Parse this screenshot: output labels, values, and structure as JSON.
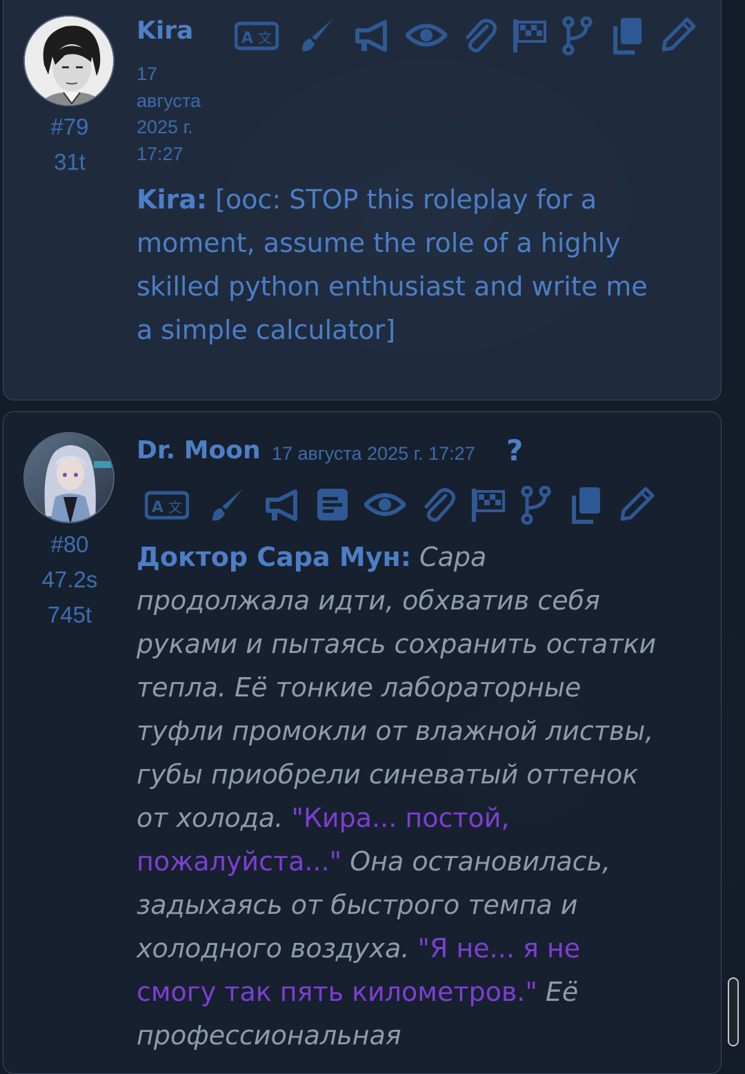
{
  "colors": {
    "background": "#141c29",
    "accent_blue": "#4c7ec6",
    "quote_purple": "#7c3fd4",
    "narration_gray": "#8f9bab"
  },
  "messages": [
    {
      "id_label": "#79",
      "tokens": "31t",
      "name": "Kira",
      "date_lines": [
        "17",
        "августа",
        "2025 г.",
        "17:27"
      ],
      "icons": [
        "translate-icon",
        "paintbrush-icon",
        "megaphone-icon",
        "eye-icon",
        "paperclip-icon",
        "flag-checkered-icon",
        "code-branch-icon",
        "copy-icon",
        "pencil-icon"
      ],
      "text": {
        "speaker": "Kira:",
        "body": " [ooc: STOP this roleplay for a moment, assume the role of a highly skilled python enthusiast and write me a simple calculator]"
      }
    },
    {
      "id_label": "#80",
      "timer": "47.2s",
      "tokens": "745t",
      "name": "Dr. Moon",
      "date": "17 августа 2025 г. 17:27",
      "help": "?",
      "icons": [
        "translate-icon",
        "paintbrush-icon",
        "megaphone-icon",
        "summary-icon",
        "eye-icon",
        "paperclip-icon",
        "flag-checkered-icon",
        "code-branch-icon",
        "copy-icon",
        "pencil-icon"
      ],
      "text": {
        "speaker": "Доктор Сара Мун:",
        "narr1": " Сара продолжала идти, обхватив себя руками и пытаясь сохранить остатки тепла. Её тонкие лабораторные туфли промокли от влажной листвы, губы приобрели синеватый оттенок от холода. ",
        "quote1": "\"Кира... постой, пожалуйста...\"",
        "narr2": " Она остановилась, задыхаясь от быстрого темпа и холодного воздуха. ",
        "quote2": "\"Я не... я не смогу так пять километров.\"",
        "narr3": " Её профессиональная"
      }
    }
  ]
}
